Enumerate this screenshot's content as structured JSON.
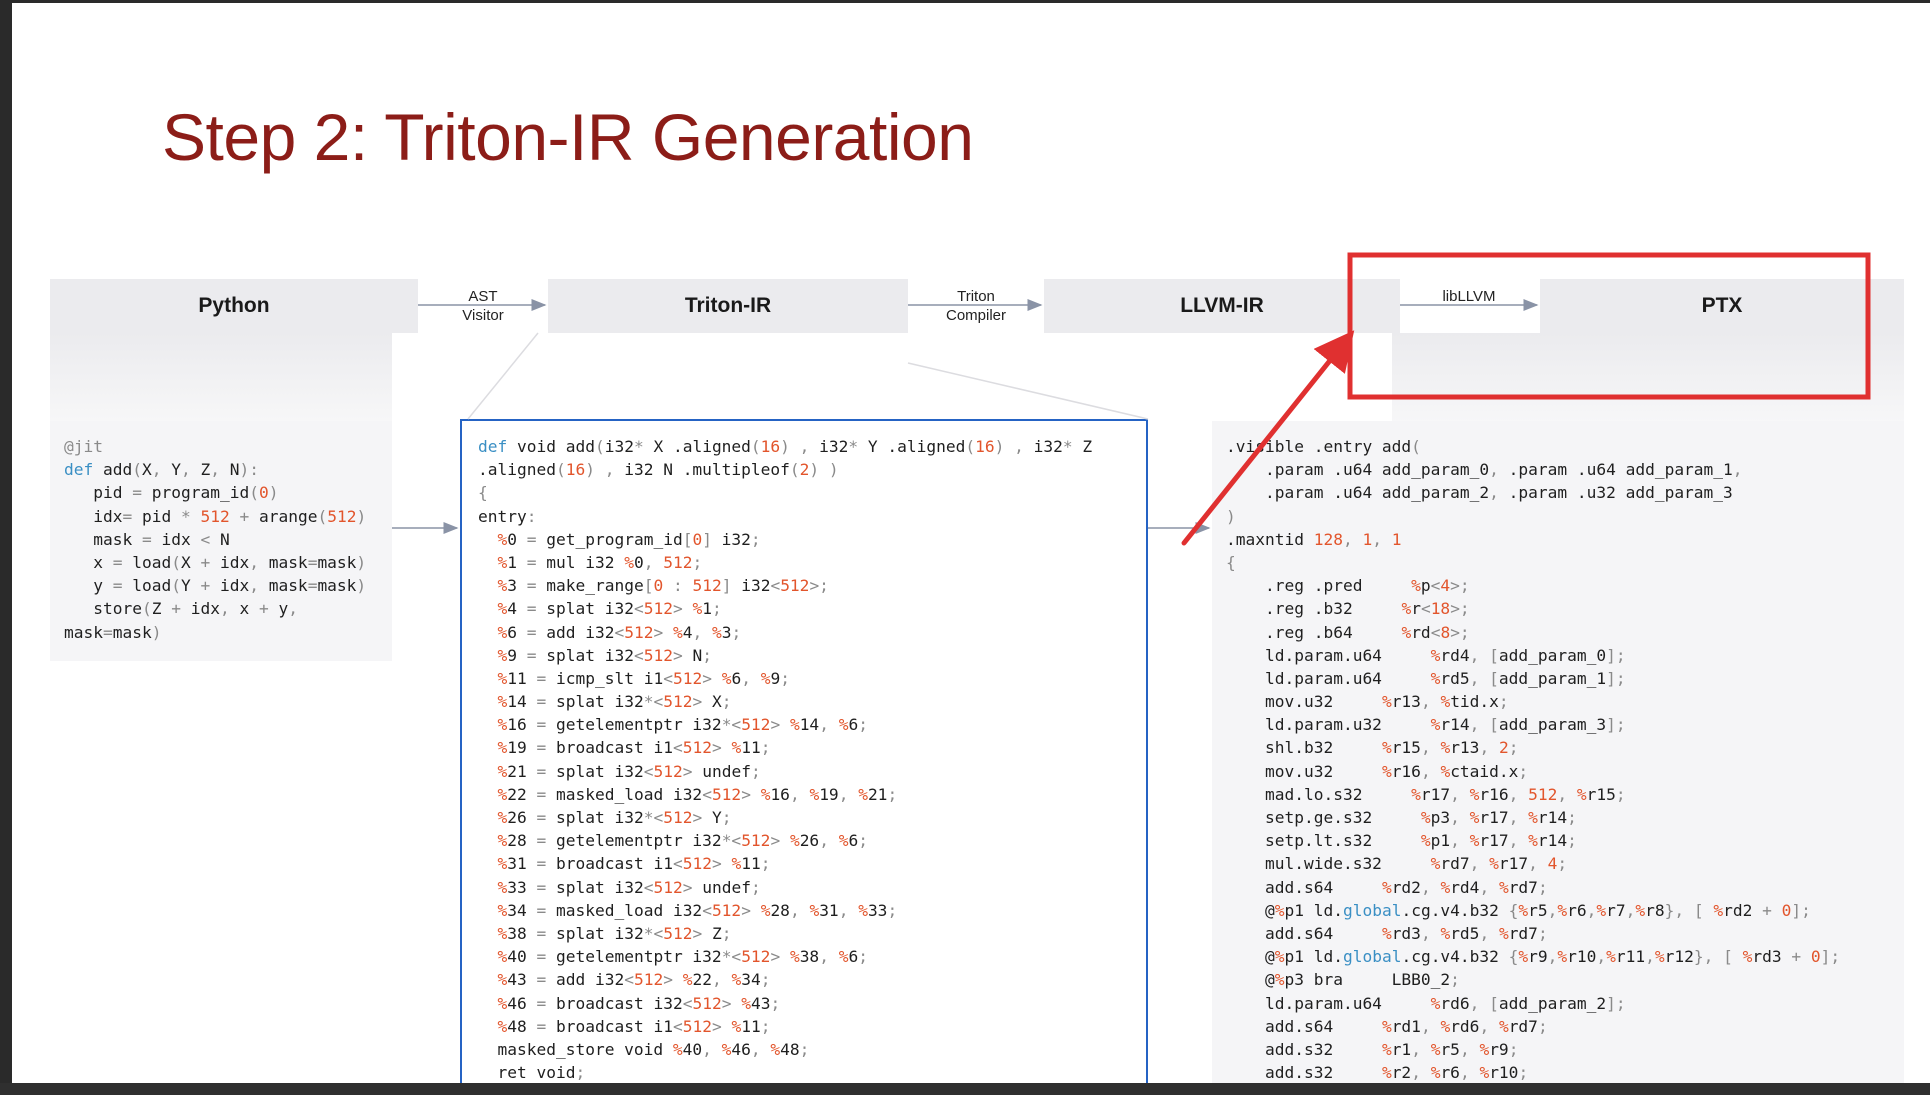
{
  "title": "Step 2: Triton-IR Generation",
  "stages": [
    "Python",
    "Triton-IR",
    "LLVM-IR",
    "PTX"
  ],
  "edges": [
    {
      "line1": "AST",
      "line2": "Visitor"
    },
    {
      "line1": "Triton",
      "line2": "Compiler"
    },
    {
      "line1": "libLLVM",
      "line2": ""
    }
  ],
  "colors": {
    "title": "#8c1d18",
    "highlight": "#e03030",
    "focus_border": "#2563c4",
    "keyword": "#3a8fc4",
    "number": "#e2552c"
  },
  "python_code": [
    "@jit",
    "def add(X, Y, Z, N):",
    "   pid = program_id(0)",
    "   idx= pid * 512 + arange(512)",
    "   mask = idx < N",
    "   x = load(X + idx, mask=mask)",
    "   y = load(Y + idx, mask=mask)",
    "   store(Z + idx, x + y,",
    "mask=mask)"
  ],
  "triton_ir_code": [
    "def void add(i32* X .aligned(16) , i32* Y .aligned(16) , i32* Z",
    ".aligned(16) , i32 N .multipleof(2) )",
    "{",
    "entry:",
    "  %0 = get_program_id[0] i32;",
    "  %1 = mul i32 %0, 512;",
    "  %3 = make_range[0 : 512] i32<512>;",
    "  %4 = splat i32<512> %1;",
    "  %6 = add i32<512> %4, %3;",
    "  %9 = splat i32<512> N;",
    "  %11 = icmp_slt i1<512> %6, %9;",
    "  %14 = splat i32*<512> X;",
    "  %16 = getelementptr i32*<512> %14, %6;",
    "  %19 = broadcast i1<512> %11;",
    "  %21 = splat i32<512> undef;",
    "  %22 = masked_load i32<512> %16, %19, %21;",
    "  %26 = splat i32*<512> Y;",
    "  %28 = getelementptr i32*<512> %26, %6;",
    "  %31 = broadcast i1<512> %11;",
    "  %33 = splat i32<512> undef;",
    "  %34 = masked_load i32<512> %28, %31, %33;",
    "  %38 = splat i32*<512> Z;",
    "  %40 = getelementptr i32*<512> %38, %6;",
    "  %43 = add i32<512> %22, %34;",
    "  %46 = broadcast i32<512> %43;",
    "  %48 = broadcast i1<512> %11;",
    "  masked_store void %40, %46, %48;",
    "  ret void;"
  ],
  "ptx_code": [
    ".visible .entry add(",
    "    .param .u64 add_param_0, .param .u64 add_param_1,",
    "    .param .u64 add_param_2, .param .u32 add_param_3",
    ")",
    ".maxntid 128, 1, 1",
    "{",
    "    .reg .pred     %p<4>;",
    "    .reg .b32     %r<18>;",
    "    .reg .b64     %rd<8>;",
    "    ld.param.u64     %rd4, [add_param_0];",
    "    ld.param.u64     %rd5, [add_param_1];",
    "    mov.u32     %r13, %tid.x;",
    "    ld.param.u32     %r14, [add_param_3];",
    "    shl.b32     %r15, %r13, 2;",
    "    mov.u32     %r16, %ctaid.x;",
    "    mad.lo.s32     %r17, %r16, 512, %r15;",
    "    setp.ge.s32     %p3, %r17, %r14;",
    "    setp.lt.s32     %p1, %r17, %r14;",
    "    mul.wide.s32     %rd7, %r17, 4;",
    "    add.s64     %rd2, %rd4, %rd7;",
    "    @%p1 ld.global.cg.v4.b32 {%r5,%r6,%r7,%r8}, [ %rd2 + 0];",
    "    add.s64     %rd3, %rd5, %rd7;",
    "    @%p1 ld.global.cg.v4.b32 {%r9,%r10,%r11,%r12}, [ %rd3 + 0];",
    "    @%p3 bra     LBB0_2;",
    "    ld.param.u64     %rd6, [add_param_2];",
    "    add.s64     %rd1, %rd6, %rd7;",
    "    add.s32     %r1, %r5, %r9;",
    "    add.s32     %r2, %r6, %r10;"
  ]
}
